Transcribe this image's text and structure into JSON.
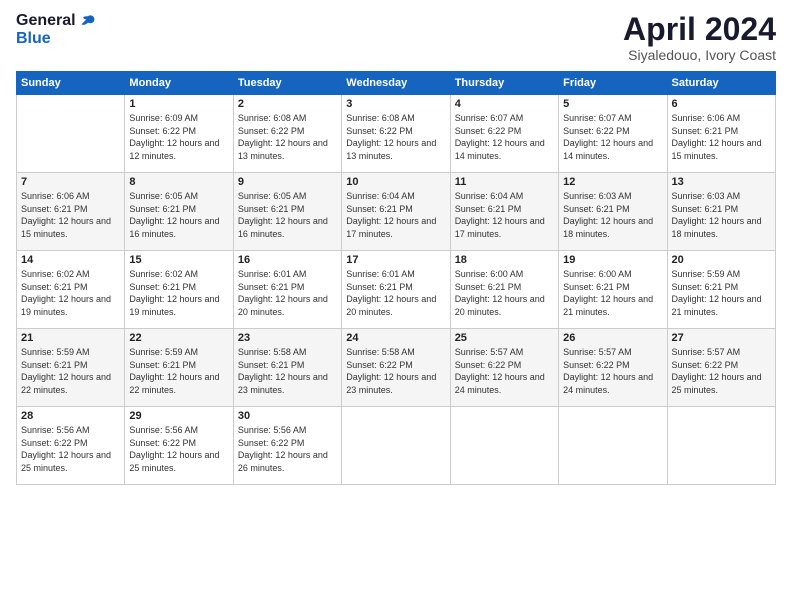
{
  "logo": {
    "general": "General",
    "blue": "Blue"
  },
  "header": {
    "month": "April 2024",
    "location": "Siyaledouo, Ivory Coast"
  },
  "weekdays": [
    "Sunday",
    "Monday",
    "Tuesday",
    "Wednesday",
    "Thursday",
    "Friday",
    "Saturday"
  ],
  "weeks": [
    [
      {
        "day": null
      },
      {
        "day": "1",
        "sunrise": "6:09 AM",
        "sunset": "6:22 PM",
        "daylight": "12 hours and 12 minutes."
      },
      {
        "day": "2",
        "sunrise": "6:08 AM",
        "sunset": "6:22 PM",
        "daylight": "12 hours and 13 minutes."
      },
      {
        "day": "3",
        "sunrise": "6:08 AM",
        "sunset": "6:22 PM",
        "daylight": "12 hours and 13 minutes."
      },
      {
        "day": "4",
        "sunrise": "6:07 AM",
        "sunset": "6:22 PM",
        "daylight": "12 hours and 14 minutes."
      },
      {
        "day": "5",
        "sunrise": "6:07 AM",
        "sunset": "6:22 PM",
        "daylight": "12 hours and 14 minutes."
      },
      {
        "day": "6",
        "sunrise": "6:06 AM",
        "sunset": "6:21 PM",
        "daylight": "12 hours and 15 minutes."
      }
    ],
    [
      {
        "day": "7",
        "sunrise": "6:06 AM",
        "sunset": "6:21 PM",
        "daylight": "12 hours and 15 minutes."
      },
      {
        "day": "8",
        "sunrise": "6:05 AM",
        "sunset": "6:21 PM",
        "daylight": "12 hours and 16 minutes."
      },
      {
        "day": "9",
        "sunrise": "6:05 AM",
        "sunset": "6:21 PM",
        "daylight": "12 hours and 16 minutes."
      },
      {
        "day": "10",
        "sunrise": "6:04 AM",
        "sunset": "6:21 PM",
        "daylight": "12 hours and 17 minutes."
      },
      {
        "day": "11",
        "sunrise": "6:04 AM",
        "sunset": "6:21 PM",
        "daylight": "12 hours and 17 minutes."
      },
      {
        "day": "12",
        "sunrise": "6:03 AM",
        "sunset": "6:21 PM",
        "daylight": "12 hours and 18 minutes."
      },
      {
        "day": "13",
        "sunrise": "6:03 AM",
        "sunset": "6:21 PM",
        "daylight": "12 hours and 18 minutes."
      }
    ],
    [
      {
        "day": "14",
        "sunrise": "6:02 AM",
        "sunset": "6:21 PM",
        "daylight": "12 hours and 19 minutes."
      },
      {
        "day": "15",
        "sunrise": "6:02 AM",
        "sunset": "6:21 PM",
        "daylight": "12 hours and 19 minutes."
      },
      {
        "day": "16",
        "sunrise": "6:01 AM",
        "sunset": "6:21 PM",
        "daylight": "12 hours and 20 minutes."
      },
      {
        "day": "17",
        "sunrise": "6:01 AM",
        "sunset": "6:21 PM",
        "daylight": "12 hours and 20 minutes."
      },
      {
        "day": "18",
        "sunrise": "6:00 AM",
        "sunset": "6:21 PM",
        "daylight": "12 hours and 20 minutes."
      },
      {
        "day": "19",
        "sunrise": "6:00 AM",
        "sunset": "6:21 PM",
        "daylight": "12 hours and 21 minutes."
      },
      {
        "day": "20",
        "sunrise": "5:59 AM",
        "sunset": "6:21 PM",
        "daylight": "12 hours and 21 minutes."
      }
    ],
    [
      {
        "day": "21",
        "sunrise": "5:59 AM",
        "sunset": "6:21 PM",
        "daylight": "12 hours and 22 minutes."
      },
      {
        "day": "22",
        "sunrise": "5:59 AM",
        "sunset": "6:21 PM",
        "daylight": "12 hours and 22 minutes."
      },
      {
        "day": "23",
        "sunrise": "5:58 AM",
        "sunset": "6:21 PM",
        "daylight": "12 hours and 23 minutes."
      },
      {
        "day": "24",
        "sunrise": "5:58 AM",
        "sunset": "6:22 PM",
        "daylight": "12 hours and 23 minutes."
      },
      {
        "day": "25",
        "sunrise": "5:57 AM",
        "sunset": "6:22 PM",
        "daylight": "12 hours and 24 minutes."
      },
      {
        "day": "26",
        "sunrise": "5:57 AM",
        "sunset": "6:22 PM",
        "daylight": "12 hours and 24 minutes."
      },
      {
        "day": "27",
        "sunrise": "5:57 AM",
        "sunset": "6:22 PM",
        "daylight": "12 hours and 25 minutes."
      }
    ],
    [
      {
        "day": "28",
        "sunrise": "5:56 AM",
        "sunset": "6:22 PM",
        "daylight": "12 hours and 25 minutes."
      },
      {
        "day": "29",
        "sunrise": "5:56 AM",
        "sunset": "6:22 PM",
        "daylight": "12 hours and 25 minutes."
      },
      {
        "day": "30",
        "sunrise": "5:56 AM",
        "sunset": "6:22 PM",
        "daylight": "12 hours and 26 minutes."
      },
      {
        "day": null
      },
      {
        "day": null
      },
      {
        "day": null
      },
      {
        "day": null
      }
    ]
  ]
}
